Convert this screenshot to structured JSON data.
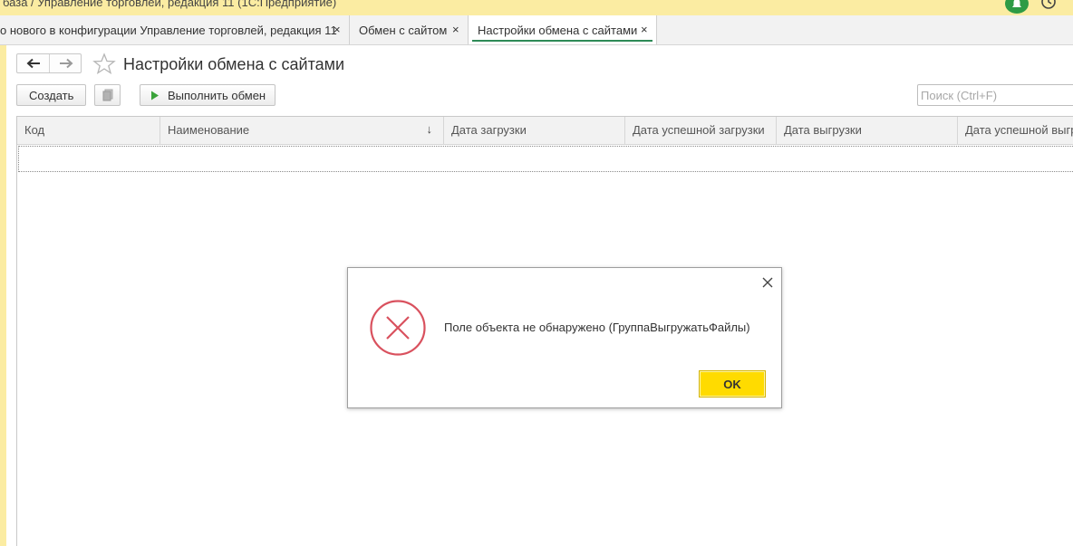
{
  "window": {
    "title": "база / Управление торговлей, редакция 11  (1С:Предприятие)"
  },
  "tabs": [
    {
      "label": "о нового в конфигурации Управление торговлей, редакция 11",
      "close": "×"
    },
    {
      "label": "Обмен с сайтом",
      "close": "×"
    },
    {
      "label": "Настройки обмена с сайтами",
      "close": "×"
    }
  ],
  "page": {
    "title": "Настройки обмена с сайтами"
  },
  "toolbar": {
    "create_label": "Создать",
    "exchange_label": "Выполнить обмен",
    "search_placeholder": "Поиск (Ctrl+F)"
  },
  "table": {
    "columns": [
      "Код",
      "Наименование",
      "Дата загрузки",
      "Дата успешной загрузки",
      "Дата выгрузки",
      "Дата успешной выгрузки"
    ],
    "sort_indicator": "↓"
  },
  "dialog": {
    "message": "Поле объекта не обнаружено (ГруппаВыгружатьФайлы)",
    "ok_label": "OK"
  },
  "colors": {
    "titlebar": "#fbeca2",
    "ok_button": "#ffdb00",
    "error_icon": "#d9515e",
    "accent_green": "#2e8b57"
  },
  "icons": [
    "notification-bell-icon",
    "history-icon",
    "back-arrow-icon",
    "forward-arrow-icon",
    "star-icon",
    "copy-icon",
    "play-icon",
    "close-icon",
    "error-icon"
  ]
}
